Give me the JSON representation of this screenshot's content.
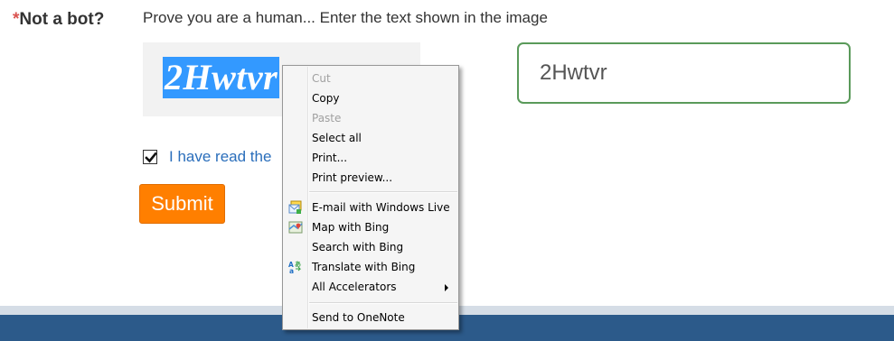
{
  "form": {
    "required_mark": "*",
    "label": "Not a bot?",
    "instructions": "Prove you are a human... Enter the text shown in the image",
    "captcha_image_text": "2Hwtvr",
    "input_value": "2Hwtvr",
    "agree_text": "I have read the",
    "submit_label": "Submit"
  },
  "context_menu": {
    "items": [
      {
        "label": "Cut",
        "enabled": false
      },
      {
        "label": "Copy",
        "enabled": true
      },
      {
        "label": "Paste",
        "enabled": false
      },
      {
        "label": "Select all",
        "enabled": true
      },
      {
        "label": "Print...",
        "enabled": true
      },
      {
        "label": "Print preview...",
        "enabled": true
      },
      {
        "label": "E-mail with Windows Live",
        "enabled": true,
        "icon": "windows-live-mail-icon"
      },
      {
        "label": "Map with Bing",
        "enabled": true,
        "icon": "bing-maps-icon"
      },
      {
        "label": "Search with Bing",
        "enabled": true
      },
      {
        "label": "Translate with Bing",
        "enabled": true,
        "icon": "translate-icon"
      },
      {
        "label": "All Accelerators",
        "enabled": true,
        "submenu": true
      },
      {
        "label": "Send to OneNote",
        "enabled": true
      }
    ]
  },
  "colors": {
    "required_mark": "#d9534f",
    "link": "#2a6ebb",
    "submit_bg": "#ff7f00",
    "input_border": "#5a9a5a",
    "selection": "#3399ff",
    "footer": "#2c5a8a"
  }
}
